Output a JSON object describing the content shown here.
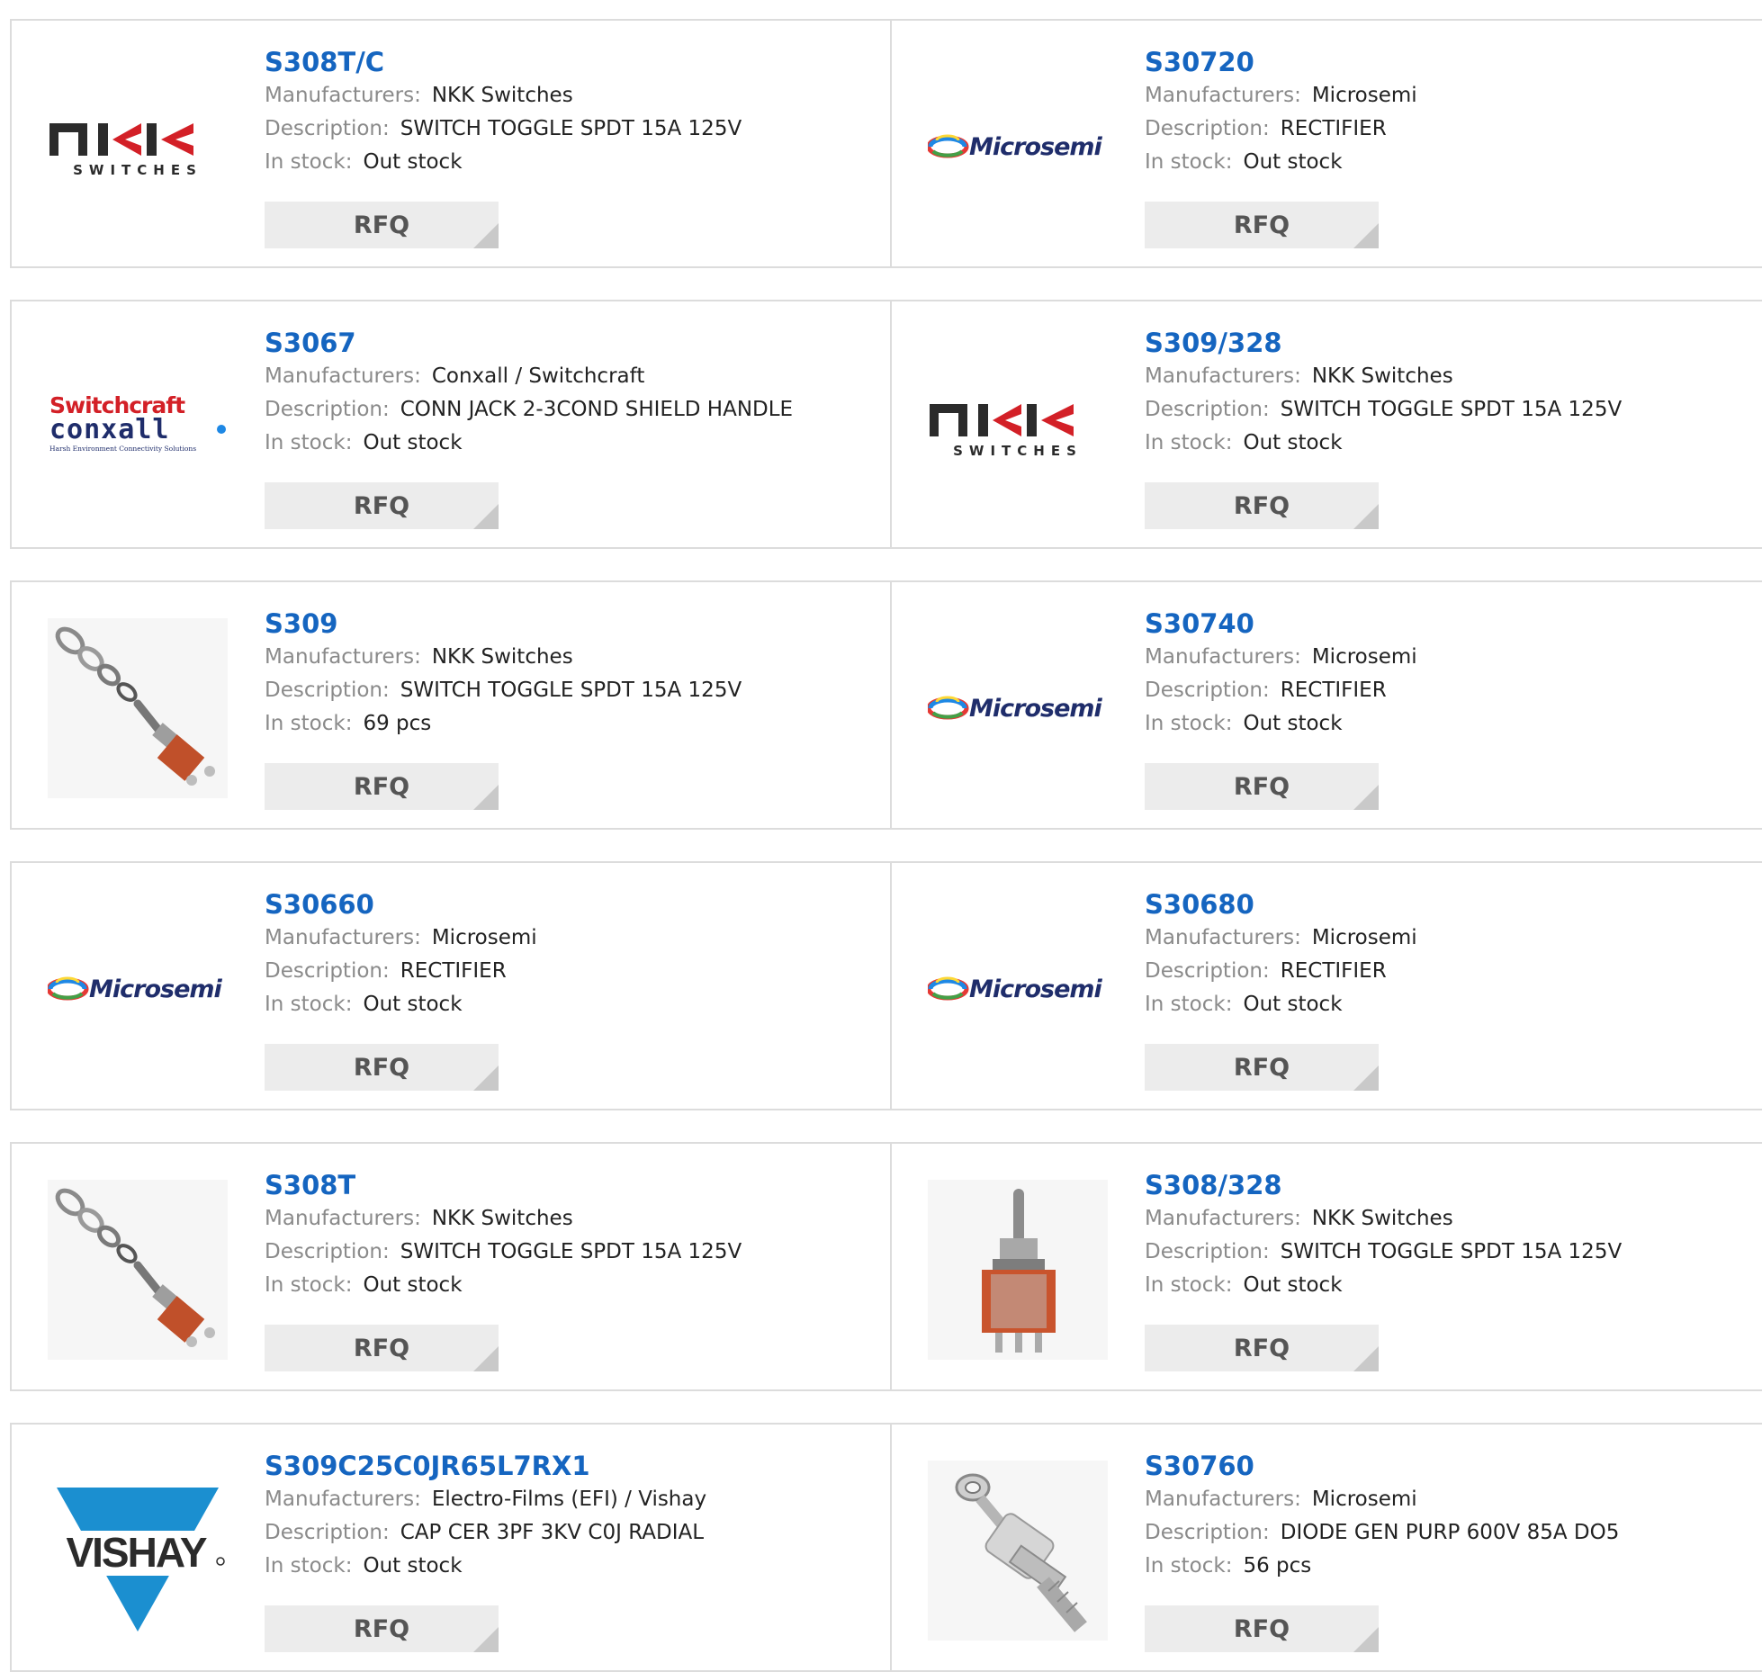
{
  "labels": {
    "manufacturers": "Manufacturers:",
    "description": "Description:",
    "in_stock": "In stock:",
    "rfq": "RFQ"
  },
  "logo_text": {
    "nkk": "NKK",
    "nkk_sub": "SWITCHES",
    "microsemi": "Microsemi",
    "switchcraft": "Switchcraft",
    "conxall": "conxall",
    "conxall_tagline": "Harsh Environment Connectivity Solutions",
    "vishay": "VISHAY"
  },
  "colors": {
    "part_link": "#1565c0",
    "label": "#8a8a8a",
    "rfq_bg": "#ececec",
    "vishay_blue": "#1b8fd0",
    "switchcraft_red": "#d32027",
    "conxall_navy": "#1f2d6b"
  },
  "products": [
    {
      "part": "S308T/C",
      "manufacturer": "NKK Switches",
      "description": "SWITCH TOGGLE SPDT 15A 125V",
      "stock": "Out stock",
      "logo": "nkk"
    },
    {
      "part": "S30720",
      "manufacturer": "Microsemi",
      "description": "RECTIFIER",
      "stock": "Out stock",
      "logo": "microsemi"
    },
    {
      "part": "S3067",
      "manufacturer": "Conxall / Switchcraft",
      "description": "CONN JACK 2-3COND SHIELD HANDLE",
      "stock": "Out stock",
      "logo": "switchcraft"
    },
    {
      "part": "S309/328",
      "manufacturer": "NKK Switches",
      "description": "SWITCH TOGGLE SPDT 15A 125V",
      "stock": "Out stock",
      "logo": "nkk"
    },
    {
      "part": "S309",
      "manufacturer": "NKK Switches",
      "description": "SWITCH TOGGLE SPDT 15A 125V",
      "stock": "69 pcs",
      "logo": "toggle-washers"
    },
    {
      "part": "S30740",
      "manufacturer": "Microsemi",
      "description": "RECTIFIER",
      "stock": "Out stock",
      "logo": "microsemi"
    },
    {
      "part": "S30660",
      "manufacturer": "Microsemi",
      "description": "RECTIFIER",
      "stock": "Out stock",
      "logo": "microsemi"
    },
    {
      "part": "S30680",
      "manufacturer": "Microsemi",
      "description": "RECTIFIER",
      "stock": "Out stock",
      "logo": "microsemi"
    },
    {
      "part": "S308T",
      "manufacturer": "NKK Switches",
      "description": "SWITCH TOGGLE SPDT 15A 125V",
      "stock": "Out stock",
      "logo": "toggle-washers"
    },
    {
      "part": "S308/328",
      "manufacturer": "NKK Switches",
      "description": "SWITCH TOGGLE SPDT 15A 125V",
      "stock": "Out stock",
      "logo": "toggle-switch"
    },
    {
      "part": "S309C25C0JR65L7RX1",
      "manufacturer": "Electro-Films (EFI) / Vishay",
      "description": "CAP CER 3PF 3KV C0J RADIAL",
      "stock": "Out stock",
      "logo": "vishay"
    },
    {
      "part": "S30760",
      "manufacturer": "Microsemi",
      "description": "DIODE GEN PURP 600V 85A DO5",
      "stock": "56 pcs",
      "logo": "stud-diode"
    }
  ]
}
